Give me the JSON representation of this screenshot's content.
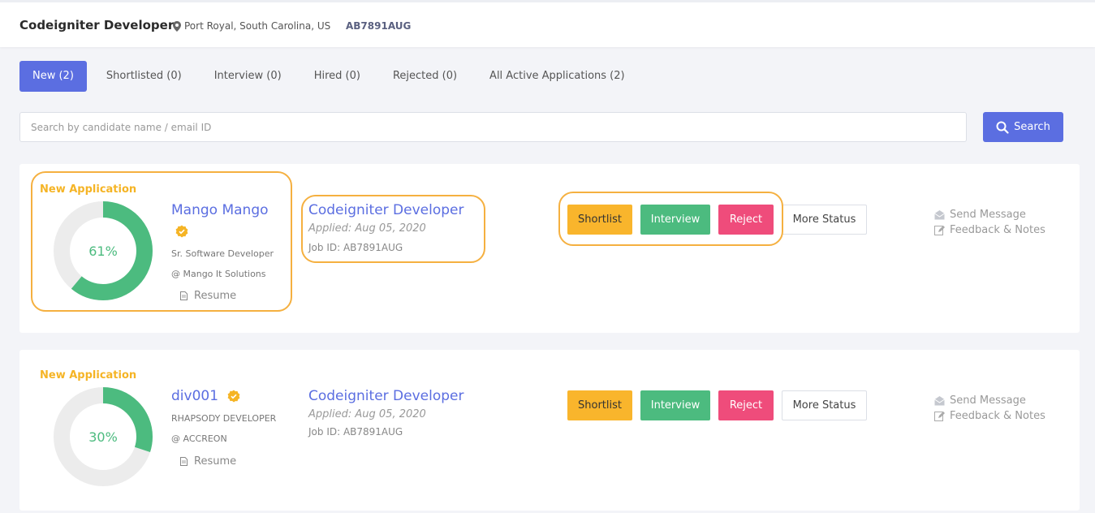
{
  "header": {
    "job_title": "Codeigniter Developer",
    "location": "Port Royal, South Carolina, US",
    "job_code": "AB7891AUG"
  },
  "tabs": [
    {
      "label": "New (2)",
      "active": true
    },
    {
      "label": "Shortlisted (0)",
      "active": false
    },
    {
      "label": "Interview (0)",
      "active": false
    },
    {
      "label": "Hired (0)",
      "active": false
    },
    {
      "label": "Rejected (0)",
      "active": false
    },
    {
      "label": "All Active Applications (2)",
      "active": false
    }
  ],
  "search": {
    "placeholder": "Search by candidate name / email ID",
    "value": "",
    "button_label": "Search"
  },
  "applications": [
    {
      "badge": "New Application",
      "match_percent": 61,
      "match_label": "61%",
      "name": "Mango Mango",
      "role": "Sr. Software Developer",
      "company": "@ Mango It Solutions",
      "resume_label": "Resume",
      "position": "Codeigniter Developer",
      "applied": "Applied: Aug 05, 2020",
      "job_id": "Job ID: AB7891AUG",
      "actions": {
        "shortlist": "Shortlist",
        "interview": "Interview",
        "reject": "Reject",
        "more": "More Status"
      },
      "send_message": "Send Message",
      "feedback": "Feedback & Notes"
    },
    {
      "badge": "New Application",
      "match_percent": 30,
      "match_label": "30%",
      "name": "div001",
      "role": "RHAPSODY DEVELOPER",
      "company": "@ ACCREON",
      "resume_label": "Resume",
      "position": "Codeigniter Developer",
      "applied": "Applied: Aug 05, 2020",
      "job_id": "Job ID: AB7891AUG",
      "actions": {
        "shortlist": "Shortlist",
        "interview": "Interview",
        "reject": "Reject",
        "more": "More Status"
      },
      "send_message": "Send Message",
      "feedback": "Feedback & Notes"
    }
  ],
  "colors": {
    "accent": "#5b6ee1",
    "shortlist": "#f9b52c",
    "interview": "#4cbb7f",
    "reject": "#ef4c7b",
    "badge": "#f5b425",
    "donut_fill": "#4cbb7f",
    "donut_track": "#ececec",
    "highlight": "#f5b040"
  },
  "icons": {
    "location": "map-pin-icon",
    "search": "search-icon",
    "verified": "verified-badge-icon",
    "resume": "document-icon",
    "send_message": "envelope-open-icon",
    "feedback": "edit-note-icon"
  }
}
